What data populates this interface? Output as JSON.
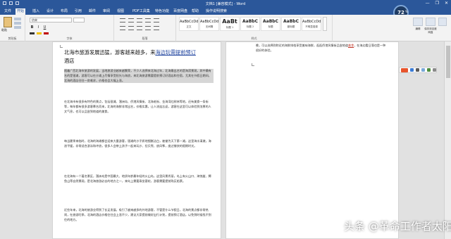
{
  "titlebar": {
    "title": "文档1 [兼容模式] - Word",
    "controls": [
      "—",
      "❐",
      "✕"
    ]
  },
  "tabs": [
    {
      "label": "文件",
      "active": false
    },
    {
      "label": "开始",
      "active": true
    },
    {
      "label": "插入",
      "active": false
    },
    {
      "label": "设计",
      "active": false
    },
    {
      "label": "布局",
      "active": false
    },
    {
      "label": "引用",
      "active": false
    },
    {
      "label": "邮件",
      "active": false
    },
    {
      "label": "审阅",
      "active": false
    },
    {
      "label": "视图",
      "active": false
    },
    {
      "label": "PDF工具集",
      "active": false
    },
    {
      "label": "特色功能",
      "active": false
    },
    {
      "label": "百度网盘",
      "active": false
    },
    {
      "label": "帮助",
      "active": false
    },
    {
      "label": "操作说明搜索",
      "active": false
    }
  ],
  "badge": {
    "value": "72",
    "unit": "%"
  },
  "ribbon": {
    "clipboard": {
      "paste_label": "粘贴",
      "group_label": "剪贴板"
    },
    "font": {
      "family": "仿宋",
      "size": "",
      "bold": "B",
      "italic": "I",
      "underline": "U",
      "group_label": "字体"
    },
    "paragraph": {
      "group_label": "段落"
    },
    "styles": {
      "group_label": "样式",
      "tiles": [
        {
          "sample": "AaBbCcDd",
          "name": "正文",
          "kind": "normal"
        },
        {
          "sample": "AaBbCcDd",
          "name": "无间隔",
          "kind": "normal"
        },
        {
          "sample": "AaBt",
          "name": "标题 1",
          "kind": "big"
        },
        {
          "sample": "AaBbC",
          "name": "标题 2",
          "kind": "mid"
        },
        {
          "sample": "AaBbC",
          "name": "标题",
          "kind": "mid"
        },
        {
          "sample": "AaBbC",
          "name": "副标题",
          "kind": "mid"
        },
        {
          "sample": "AaBbCcDd",
          "name": "不明显强调",
          "kind": "normal"
        },
        {
          "sample": "AaBbCcDd",
          "name": "强调",
          "kind": "normal"
        },
        {
          "sample": "AaBbCcDd",
          "name": "明显强调",
          "kind": "normal"
        }
      ]
    },
    "right_tools": [
      {
        "label": "编辑"
      },
      {
        "label": "保存到百度网盘"
      },
      {
        "label": "论文查重"
      }
    ]
  },
  "document": {
    "left_page": {
      "title_plain": "北海市旅游发展迅猛，游客越来越多，来",
      "title_underlined": "海边玩需提前预订",
      "title_end": "酒店",
      "paragraphs": [
        "随着广西北海市旅游的发展，当地旅游业越来越繁荣，不少人选择来北海过年，北海最出名的是海滨景观，其中最有名的是银滩，游客可以在沙滩上尽情享受阳光与海浪，来北海旅游需要提前预订好酒店和住宿，尤其在节假日期间，北海的酒店往往一房难求，价格也会大幅上涨。",
        "在北海市有很多有特色的景点，包括银滩、涠洲岛、侨港风情街、北海老街、金海湾红树林等地，还有美食一条街等，每年都有很多游客慕名而来，北海的海鲜非常出名，价格实惠，让人流连忘返，游客在这里可以体验到浓厚的人文气息，也可以品尝到地道的美食。",
        "每当夏季来临时，北海的海滩都会迎来大量游客，银滩的沙子质地细腻洁白，被誉为天下第一滩，这里海水清澈，海浪平缓，非常适合游泳和冲浪，很多人会带上孩子一起来玩沙、捡贝壳、放风筝，度过愉快的假期时光。",
        "在北海有一个著名景区，涠洲岛是中国最大、地质年龄最年轻的火山岛，这里风景秀丽，岛上有火山口、海蚀崖、鳄鱼山等自然景观，是北海旅游必去的地方之一，来岛上需要乘坐客轮，游客需要提前购买船票。",
        "近些年来，北海的旅游业得到了长足发展，吸引了越来越多的外地游客，不管是什么节假日，北海的景点都非常热闹，在旅游旺季，北海的酒店价格往往会上涨不少，建议大家提前做好出行计划，提前预订酒店，以免到时候找不到住的地方。"
      ]
    },
    "right_page": {
      "text_plain": "晚，可以选择到附近的海鲜排档享受美味海鲜，逛逛侨港风情街品尝地道",
      "text_red": "美食",
      "text_end": "，在海边看日落也是一种很好的体验。"
    }
  },
  "watermark": "头条 @革命工作者太阳"
}
